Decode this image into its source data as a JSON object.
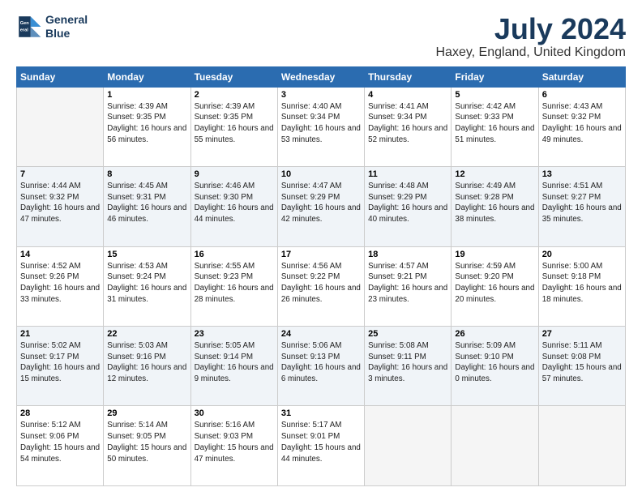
{
  "logo": {
    "line1": "General",
    "line2": "Blue"
  },
  "title": "July 2024",
  "location": "Haxey, England, United Kingdom",
  "days_of_week": [
    "Sunday",
    "Monday",
    "Tuesday",
    "Wednesday",
    "Thursday",
    "Friday",
    "Saturday"
  ],
  "weeks": [
    [
      {
        "day": "",
        "empty": true
      },
      {
        "day": "1",
        "sunrise": "4:39 AM",
        "sunset": "9:35 PM",
        "daylight": "16 hours and 56 minutes."
      },
      {
        "day": "2",
        "sunrise": "4:39 AM",
        "sunset": "9:35 PM",
        "daylight": "16 hours and 55 minutes."
      },
      {
        "day": "3",
        "sunrise": "4:40 AM",
        "sunset": "9:34 PM",
        "daylight": "16 hours and 53 minutes."
      },
      {
        "day": "4",
        "sunrise": "4:41 AM",
        "sunset": "9:34 PM",
        "daylight": "16 hours and 52 minutes."
      },
      {
        "day": "5",
        "sunrise": "4:42 AM",
        "sunset": "9:33 PM",
        "daylight": "16 hours and 51 minutes."
      },
      {
        "day": "6",
        "sunrise": "4:43 AM",
        "sunset": "9:32 PM",
        "daylight": "16 hours and 49 minutes."
      }
    ],
    [
      {
        "day": "7",
        "sunrise": "4:44 AM",
        "sunset": "9:32 PM",
        "daylight": "16 hours and 47 minutes."
      },
      {
        "day": "8",
        "sunrise": "4:45 AM",
        "sunset": "9:31 PM",
        "daylight": "16 hours and 46 minutes."
      },
      {
        "day": "9",
        "sunrise": "4:46 AM",
        "sunset": "9:30 PM",
        "daylight": "16 hours and 44 minutes."
      },
      {
        "day": "10",
        "sunrise": "4:47 AM",
        "sunset": "9:29 PM",
        "daylight": "16 hours and 42 minutes."
      },
      {
        "day": "11",
        "sunrise": "4:48 AM",
        "sunset": "9:29 PM",
        "daylight": "16 hours and 40 minutes."
      },
      {
        "day": "12",
        "sunrise": "4:49 AM",
        "sunset": "9:28 PM",
        "daylight": "16 hours and 38 minutes."
      },
      {
        "day": "13",
        "sunrise": "4:51 AM",
        "sunset": "9:27 PM",
        "daylight": "16 hours and 35 minutes."
      }
    ],
    [
      {
        "day": "14",
        "sunrise": "4:52 AM",
        "sunset": "9:26 PM",
        "daylight": "16 hours and 33 minutes."
      },
      {
        "day": "15",
        "sunrise": "4:53 AM",
        "sunset": "9:24 PM",
        "daylight": "16 hours and 31 minutes."
      },
      {
        "day": "16",
        "sunrise": "4:55 AM",
        "sunset": "9:23 PM",
        "daylight": "16 hours and 28 minutes."
      },
      {
        "day": "17",
        "sunrise": "4:56 AM",
        "sunset": "9:22 PM",
        "daylight": "16 hours and 26 minutes."
      },
      {
        "day": "18",
        "sunrise": "4:57 AM",
        "sunset": "9:21 PM",
        "daylight": "16 hours and 23 minutes."
      },
      {
        "day": "19",
        "sunrise": "4:59 AM",
        "sunset": "9:20 PM",
        "daylight": "16 hours and 20 minutes."
      },
      {
        "day": "20",
        "sunrise": "5:00 AM",
        "sunset": "9:18 PM",
        "daylight": "16 hours and 18 minutes."
      }
    ],
    [
      {
        "day": "21",
        "sunrise": "5:02 AM",
        "sunset": "9:17 PM",
        "daylight": "16 hours and 15 minutes."
      },
      {
        "day": "22",
        "sunrise": "5:03 AM",
        "sunset": "9:16 PM",
        "daylight": "16 hours and 12 minutes."
      },
      {
        "day": "23",
        "sunrise": "5:05 AM",
        "sunset": "9:14 PM",
        "daylight": "16 hours and 9 minutes."
      },
      {
        "day": "24",
        "sunrise": "5:06 AM",
        "sunset": "9:13 PM",
        "daylight": "16 hours and 6 minutes."
      },
      {
        "day": "25",
        "sunrise": "5:08 AM",
        "sunset": "9:11 PM",
        "daylight": "16 hours and 3 minutes."
      },
      {
        "day": "26",
        "sunrise": "5:09 AM",
        "sunset": "9:10 PM",
        "daylight": "16 hours and 0 minutes."
      },
      {
        "day": "27",
        "sunrise": "5:11 AM",
        "sunset": "9:08 PM",
        "daylight": "15 hours and 57 minutes."
      }
    ],
    [
      {
        "day": "28",
        "sunrise": "5:12 AM",
        "sunset": "9:06 PM",
        "daylight": "15 hours and 54 minutes."
      },
      {
        "day": "29",
        "sunrise": "5:14 AM",
        "sunset": "9:05 PM",
        "daylight": "15 hours and 50 minutes."
      },
      {
        "day": "30",
        "sunrise": "5:16 AM",
        "sunset": "9:03 PM",
        "daylight": "15 hours and 47 minutes."
      },
      {
        "day": "31",
        "sunrise": "5:17 AM",
        "sunset": "9:01 PM",
        "daylight": "15 hours and 44 minutes."
      },
      {
        "day": "",
        "empty": true
      },
      {
        "day": "",
        "empty": true
      },
      {
        "day": "",
        "empty": true
      }
    ]
  ]
}
